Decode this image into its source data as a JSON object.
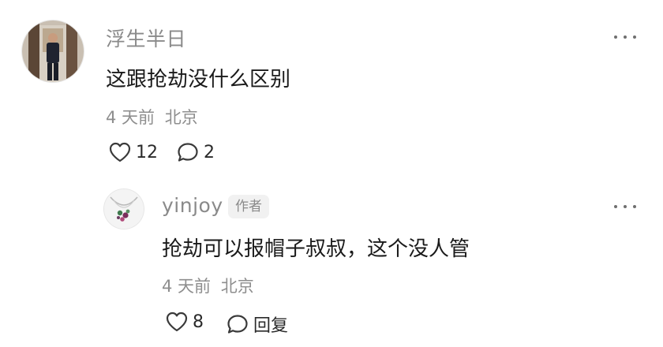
{
  "comment": {
    "username": "浮生半日",
    "text": "这跟抢劫没什么区别",
    "time": "4 天前",
    "location": "北京",
    "like_count": "12",
    "reply_count": "2"
  },
  "reply": {
    "username": "yinjoy",
    "author_badge": "作者",
    "text": "抢劫可以报帽子叔叔，这个没人管",
    "time": "4 天前",
    "location": "北京",
    "like_count": "8",
    "reply_label": "回复"
  },
  "icons": {
    "heart": "heart-outline-icon",
    "comment": "chat-bubble-icon",
    "more": "more-horizontal-icon"
  },
  "colors": {
    "username": "#8a8a8a",
    "text": "#1a1a1a",
    "meta": "#8e8e8e",
    "badge_bg": "#f1f1f1"
  }
}
